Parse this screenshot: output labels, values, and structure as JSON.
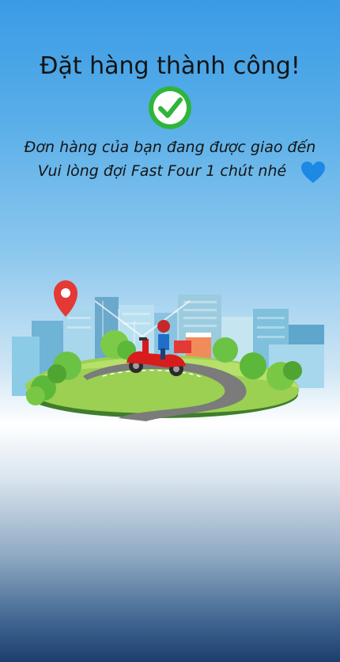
{
  "confirmation": {
    "title": "Đặt hàng thành công!",
    "message_line1": "Đơn hàng của bạn đang được giao đến",
    "message_line2": "Vui lòng đợi Fast Four 1 chút nhé"
  },
  "icons": {
    "success": "check-circle-icon",
    "heart": "heart-icon",
    "location": "map-pin-icon"
  },
  "colors": {
    "check_green": "#2fb53a",
    "heart_blue": "#1e88e5",
    "pin_red": "#e53935",
    "scooter_red": "#d81c1c"
  }
}
